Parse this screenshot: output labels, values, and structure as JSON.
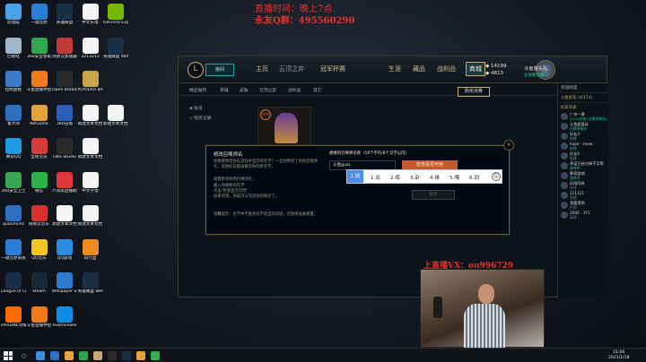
{
  "desktop": {
    "icons": [
      {
        "label": "此电脑",
        "color": "#4aa3e8"
      },
      {
        "label": "一键还原",
        "color": "#2c7dd4"
      },
      {
        "label": "英雄联盟",
        "color": "#1a3047"
      },
      {
        "label": "中文乐谱",
        "color": "#f4f4f4"
      },
      {
        "label": "GeForce Experience",
        "color": "#76b900"
      },
      {
        "label": "回收站",
        "color": "#9fb6c8"
      },
      {
        "label": "360安全管家",
        "color": "#2fa84f"
      },
      {
        "label": "网易云加速器",
        "color": "#c23b3b"
      },
      {
        "label": "3213213",
        "color": "#f4f4f4"
      },
      {
        "label": "英雄联盟 WeGame版",
        "color": "#1a3047"
      },
      {
        "label": "控制面板",
        "color": "#3d7cc9"
      },
      {
        "label": "斗鱼直播伴侣",
        "color": "#f07b1a"
      },
      {
        "label": "Open Broadcast",
        "color": "#2b2b2b"
      },
      {
        "label": "PLAYERU BATTLEGR",
        "color": "#c9a64a"
      },
      {
        "label": "",
        "color": "transparent"
      },
      {
        "label": "鲁大师",
        "color": "#2e6fc2"
      },
      {
        "label": "WeGame",
        "color": "#e2a43a"
      },
      {
        "label": "360压缩",
        "color": "#2e5fb8"
      },
      {
        "label": "新建文本文档",
        "color": "#f4f4f4"
      },
      {
        "label": "新建文本文档(2)",
        "color": "#f4f4f4"
      },
      {
        "label": "腾讯QQ",
        "color": "#1f9be6"
      },
      {
        "label": "全民音乐",
        "color": "#d43c3c"
      },
      {
        "label": "OBS Studio",
        "color": "#2b2b2b"
      },
      {
        "label": "新建文本文档",
        "color": "#f4f4f4"
      },
      {
        "label": "",
        "color": "transparent"
      },
      {
        "label": "360安全卫士",
        "color": "#3aa655"
      },
      {
        "label": "微信",
        "color": "#2cb24a"
      },
      {
        "label": "六间房直播助手",
        "color": "#e0373b"
      },
      {
        "label": "中文字谱",
        "color": "#f4f4f4"
      },
      {
        "label": "",
        "color": "transparent"
      },
      {
        "label": "quanminlz",
        "color": "#2d6fc2"
      },
      {
        "label": "网易云音乐",
        "color": "#d8312e"
      },
      {
        "label": "新建文本文档",
        "color": "#f4f4f4"
      },
      {
        "label": "新建文本文档",
        "color": "#f4f4f4"
      },
      {
        "label": "",
        "color": "transparent"
      },
      {
        "label": "一键还原系统",
        "color": "#2c7dd4"
      },
      {
        "label": "QQ音乐",
        "color": "#f3c623"
      },
      {
        "label": "QQ游戏",
        "color": "#2a8be0"
      },
      {
        "label": "风行盒",
        "color": "#f08b22"
      },
      {
        "label": "",
        "color": "transparent"
      },
      {
        "label": "League of Legends",
        "color": "#1a3047"
      },
      {
        "label": "Steam",
        "color": "#1b2838"
      },
      {
        "label": "Wallpaper Engine",
        "color": "#2f7ad0"
      },
      {
        "label": "英雄联盟 WeGame版",
        "color": "#1a3047"
      },
      {
        "label": "",
        "color": "transparent"
      },
      {
        "label": "iPASONE功能软件",
        "color": "#ff6a00"
      },
      {
        "label": "斗鱼直播伴侣",
        "color": "#f07b1a"
      },
      {
        "label": "TeamViewer",
        "color": "#0e8ee9"
      }
    ]
  },
  "overlay": {
    "line1": "直播时间：晚上7点",
    "line2": "永友Q群：495560290",
    "cam_title": "上直播VX：ou996729"
  },
  "client": {
    "logo": "L",
    "play": "房间",
    "tabs": [
      "主页",
      "云顶之弈",
      "冠军杯赛",
      "生涯",
      "藏品",
      "战利品",
      "商城"
    ],
    "currency": {
      "rp": "14199",
      "be": "4813"
    },
    "profile": {
      "name": "斗鱼饿头丸",
      "status": "在线服务器(1)"
    },
    "subtabs": [
      "精品推荐",
      "英雄",
      "皮肤",
      "云顶之弈",
      "战利品",
      "其它"
    ],
    "buy_button": "购买点券",
    "side_options": [
      "账号",
      "购买记录"
    ],
    "item_badge": "20%"
  },
  "modal": {
    "title": "修改召唤师名",
    "desc1": "你想要更改你在游戏中显示的名字？一旦你更改了你的召唤师名，其他好友都会看见你的新名字。",
    "desc2": "如需更改你的召唤师名：",
    "steps": [
      "输入你想要的名字",
      "点击\"检查是否可用\"",
      "如果可用，你就可以完成你的购买了。"
    ],
    "note": "温馨提示：名字中不能含有不适当的词语，否则将会被重置。",
    "right_label": "想要的召唤师名称（16个字符/8个汉字以内）",
    "input_value": "斗鱼guai",
    "check_button": "检查是否可用",
    "ok_button": "确定",
    "close": "×"
  },
  "ime": {
    "candidates": [
      "1.瓜",
      "2.呱",
      "3.卦",
      "4.褂",
      "5.嘎",
      "6.刮"
    ],
    "first": "1.挂"
  },
  "friends": {
    "header": "英雄联盟",
    "sections": [
      {
        "title": "斗鱼好友 (4/173)"
      },
      {
        "title": "好友列表"
      }
    ],
    "list": [
      {
        "name": "广州一哥",
        "status": "15:00开始 (召唤师峡谷)",
        "online": true
      },
      {
        "name": "斗鱼超爱玩",
        "status": "召唤师峡谷",
        "online": true
      },
      {
        "name": "好友3",
        "status": "在线",
        "online": true
      },
      {
        "name": "hope · snow",
        "status": "在线",
        "online": true
      },
      {
        "name": "好友5",
        "status": "在线",
        "online": true
      },
      {
        "name": "承诺已经对神不可等",
        "status": "游戏中",
        "online": true
      },
      {
        "name": "朝荷游戏",
        "status": "游戏中",
        "online": true
      },
      {
        "name": "风雨同舟",
        "status": "在线",
        "online": false
      },
      {
        "name": "111111",
        "status": "在线",
        "online": true
      },
      {
        "name": "我要得到",
        "status": "在线",
        "online": false
      },
      {
        "name": "2000 · 3Y1",
        "status": "离线",
        "online": false
      }
    ]
  },
  "taskbar": {
    "time": "21:06",
    "date": "2021/1/18",
    "search": "○"
  }
}
